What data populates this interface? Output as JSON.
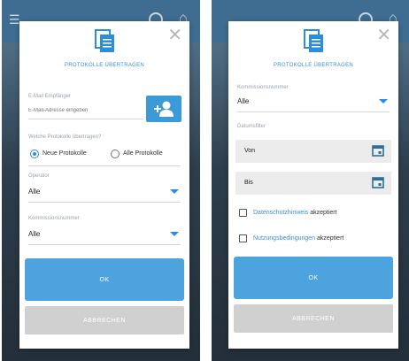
{
  "colors": {
    "accent": "#2b8de0",
    "ok_button": "#4da3dd",
    "cancel_button": "#d0d0d0",
    "title_text": "#3a8fd6"
  },
  "left": {
    "title": "PROTOKOLLE ÜBERTRAGEN",
    "email": {
      "label": "E-Mail Empfänger",
      "placeholder": "E-Mail-Adresse eingeben"
    },
    "protocol_question": "Welche Protokolle übertragen?",
    "radio_new": "Neue Protokolle",
    "radio_all": "Alle Protokolle",
    "radio_selected": "new",
    "operator": {
      "label": "Operator",
      "value": "Alle"
    },
    "commission": {
      "label": "Kommissionsnummer",
      "value": "Alle"
    },
    "ok": "OK",
    "cancel": "ABBRECHEN"
  },
  "right": {
    "title": "PROTOKOLLE ÜBERTRAGEN",
    "commission": {
      "label": "Kommissionsnummer",
      "value": "Alle"
    },
    "date_filter_label": "Datumsfilter",
    "from": "Von",
    "to": "Bis",
    "privacy_link": "Datenschutzhinweis",
    "privacy_suffix": " akzeptiert",
    "terms_link": "Nutzungsbedingungen",
    "terms_suffix": " akzeptiert",
    "ok": "OK",
    "cancel": "ABBRECHEN"
  },
  "icons": [
    "menu-icon",
    "cloud-sync-icon",
    "home-icon",
    "document-icon",
    "close-icon",
    "add-user-icon",
    "calendar-icon",
    "chevron-down-icon"
  ]
}
